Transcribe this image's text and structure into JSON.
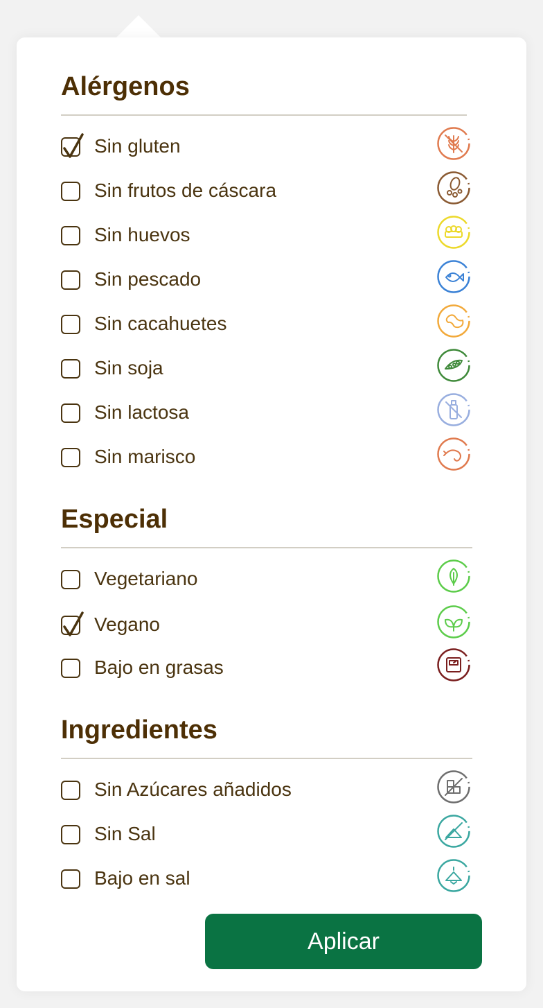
{
  "sections": [
    {
      "title": "Alérgenos",
      "items": [
        {
          "label": "Sin gluten",
          "checked": true,
          "icon": "wheat-icon",
          "color": "#e07a4e"
        },
        {
          "label": "Sin frutos de cáscara",
          "checked": false,
          "icon": "nuts-icon",
          "color": "#8a5a32"
        },
        {
          "label": "Sin huevos",
          "checked": false,
          "icon": "eggs-icon",
          "color": "#ecd92a"
        },
        {
          "label": "Sin pescado",
          "checked": false,
          "icon": "fish-icon",
          "color": "#3b82d6"
        },
        {
          "label": "Sin cacahuetes",
          "checked": false,
          "icon": "peanut-icon",
          "color": "#f2a93a"
        },
        {
          "label": "Sin soja",
          "checked": false,
          "icon": "soy-icon",
          "color": "#3f8a3a"
        },
        {
          "label": "Sin lactosa",
          "checked": false,
          "icon": "milk-bottle-icon",
          "color": "#98aedf"
        },
        {
          "label": "Sin marisco",
          "checked": false,
          "icon": "shrimp-icon",
          "color": "#e07a4e"
        }
      ]
    },
    {
      "title": "Especial",
      "items": [
        {
          "label": "Vegetariano",
          "checked": false,
          "icon": "leaf-icon",
          "color": "#5ccc4a"
        },
        {
          "label": "Vegano",
          "checked": true,
          "icon": "leaves-icon",
          "color": "#5ccc4a"
        },
        {
          "label": "Bajo en grasas",
          "checked": false,
          "icon": "scale-icon",
          "color": "#7a1e1e"
        }
      ]
    },
    {
      "title": "Ingredientes",
      "items": [
        {
          "label": "Sin Azúcares añadidos",
          "checked": false,
          "icon": "sugar-cubes-icon",
          "color": "#6e6e6e"
        },
        {
          "label": "Sin Sal",
          "checked": false,
          "icon": "no-salt-icon",
          "color": "#3aa7a0"
        },
        {
          "label": "Bajo en sal",
          "checked": false,
          "icon": "salt-pile-icon",
          "color": "#3aa7a0"
        }
      ]
    }
  ],
  "apply_label": "Aplicar"
}
